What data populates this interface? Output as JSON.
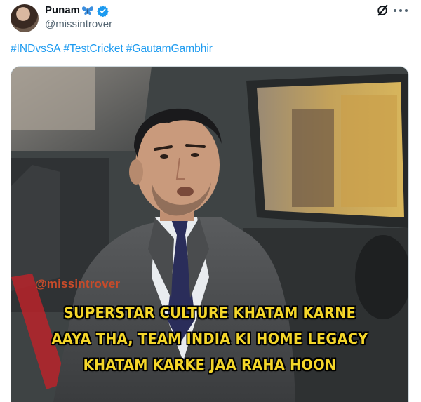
{
  "author": {
    "display_name": "Punam",
    "emoji": "butterfly-emoji",
    "handle": "@missintrover",
    "verified": true
  },
  "icons": {
    "grok": "grok-icon",
    "more": "more-options-icon"
  },
  "tweet": {
    "hashtags": [
      "#INDvsSA",
      "#TestCricket",
      "#GautamGambhir"
    ]
  },
  "media": {
    "watermark": "@missintrover",
    "caption_lines": [
      "SUPERSTAR CULTURE KHATAM KARNE",
      "AAYA THA, TEAM INDIA KI HOME LEGACY",
      "KHATAM KARKE JAA RAHA HOON"
    ]
  },
  "colors": {
    "link": "#1d9bf0",
    "verified": "#1d9bf0",
    "caption": "#f4d62a",
    "watermark": "#c74b2a"
  }
}
